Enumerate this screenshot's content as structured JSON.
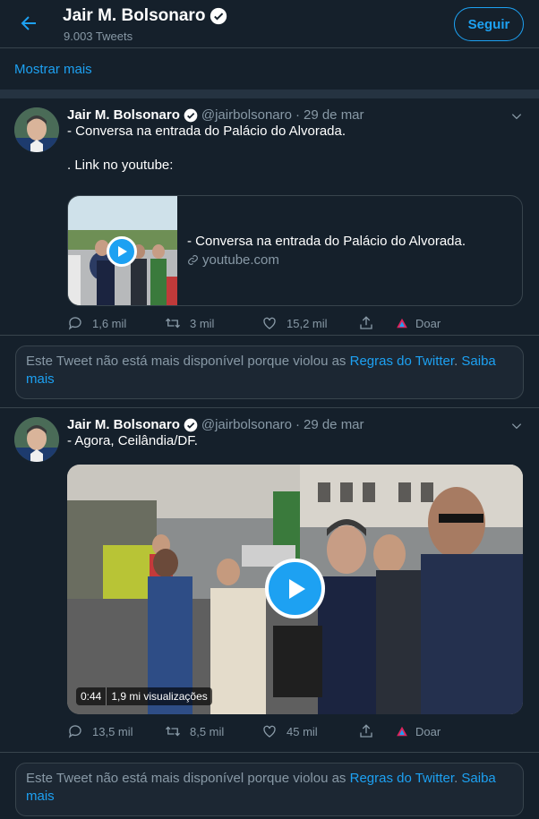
{
  "header": {
    "name": "Jair M. Bolsonaro",
    "tweet_count": "9.003 Tweets",
    "follow_label": "Seguir"
  },
  "show_more": "Mostrar mais",
  "tweets": [
    {
      "name": "Jair M. Bolsonaro",
      "handle": "@jairbolsonaro",
      "sep": "·",
      "date": "29 de mar",
      "line1": "- Conversa na entrada do Palácio do Alvorada.",
      "line2": ". Link no youtube:",
      "card_title": "- Conversa na entrada do Palácio do Alvorada.",
      "card_domain": "youtube.com",
      "replies": "1,6 mil",
      "retweets": "3 mil",
      "likes": "15,2 mil",
      "donate": "Doar"
    },
    {
      "name": "Jair M. Bolsonaro",
      "handle": "@jairbolsonaro",
      "sep": "·",
      "date": "29 de mar",
      "line1": "- Agora, Ceilândia/DF.",
      "duration": "0:44",
      "views": "1,9 mi visualizações",
      "replies": "13,5 mil",
      "retweets": "8,5 mil",
      "likes": "45 mil",
      "donate": "Doar"
    }
  ],
  "notice": {
    "text": "Este Tweet não está mais disponível porque violou as ",
    "link1": "Regras do Twitter",
    "dot": ".",
    "link2": "Saiba mais"
  },
  "colors": {
    "background": "#15202b",
    "accent": "#1da1f2",
    "muted": "#8899a6",
    "border": "#38444d"
  }
}
